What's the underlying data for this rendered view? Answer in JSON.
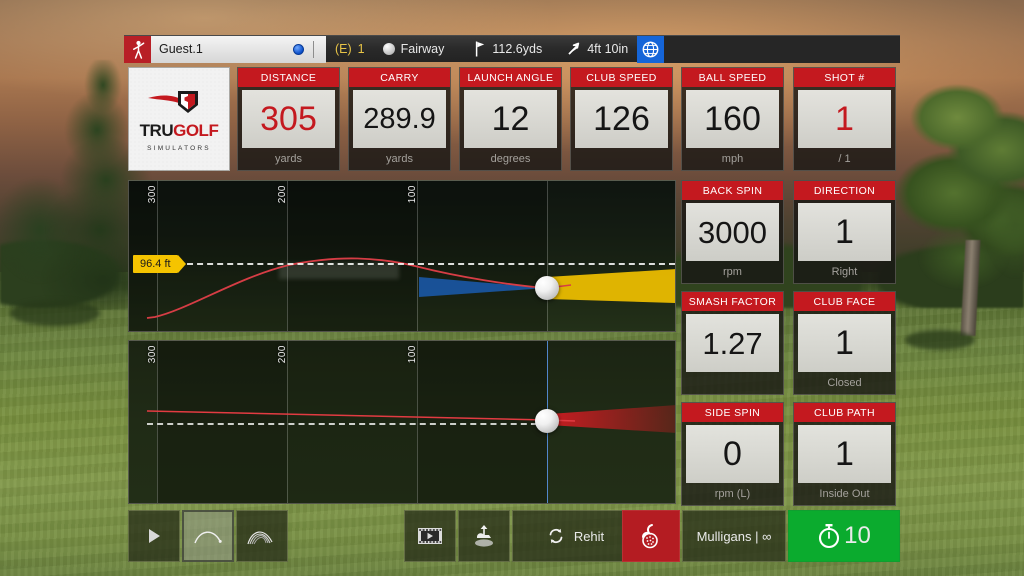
{
  "header": {
    "logo_icon": "golfer-swing-icon",
    "player_name": "Guest.1",
    "ball_marker_icon": "blue-ball-marker-icon",
    "score_paren": "(E)",
    "score_value": "1",
    "lie_ball_icon": "white-ball-icon",
    "lie": "Fairway",
    "flag_icon": "flag-icon",
    "distance_to_pin": "112.6yds",
    "elevation_icon": "up-right-arrow-icon",
    "elevation": "4ft 10in",
    "globe_icon": "globe-icon"
  },
  "brand": {
    "mark_icon": "trugolf-shield-icon",
    "name_part1": "TRU",
    "name_part2": "GOLF",
    "subtitle": "SIMULATORS"
  },
  "stats": [
    {
      "title": "DISTANCE",
      "value": "305",
      "unit": "yards",
      "accent": true
    },
    {
      "title": "CARRY",
      "value": "289.9",
      "unit": "yards",
      "accent": false
    },
    {
      "title": "LAUNCH ANGLE",
      "value": "12",
      "unit": "degrees",
      "accent": false
    },
    {
      "title": "CLUB SPEED",
      "value": "126",
      "unit": "",
      "accent": false
    },
    {
      "title": "BALL SPEED",
      "value": "160",
      "unit": "mph",
      "accent": false
    },
    {
      "title": "SHOT #",
      "value": "1",
      "unit": "/ 1",
      "accent": true
    },
    {
      "title": "BACK SPIN",
      "value": "3000",
      "unit": "rpm",
      "accent": false
    },
    {
      "title": "DIRECTION",
      "value": "1",
      "unit": "Right",
      "accent": false
    },
    {
      "title": "SMASH FACTOR",
      "value": "1.27",
      "unit": "",
      "accent": false
    },
    {
      "title": "CLUB FACE",
      "value": "1",
      "unit": "Closed",
      "accent": false
    },
    {
      "title": "SIDE SPIN",
      "value": "0",
      "unit": "rpm (L)",
      "accent": false
    },
    {
      "title": "CLUB PATH",
      "value": "1",
      "unit": "Inside Out",
      "accent": false
    }
  ],
  "side_view": {
    "name": "side-trajectory-view",
    "tick_labels": [
      "300",
      "200",
      "100"
    ],
    "apex_label": "96.4 ft"
  },
  "top_view": {
    "name": "top-down-trajectory-view",
    "tick_labels": [
      "300",
      "200",
      "100"
    ]
  },
  "toolbar": {
    "play_icon": "play-icon",
    "side_view_icon": "side-trajectory-icon",
    "multi_shot_icon": "multi-shot-trajectory-icon",
    "film_icon": "film-replay-icon",
    "drop_icon": "drop-ball-icon",
    "rehit_icon": "refresh-icon",
    "rehit_label": "Rehit",
    "mulligan_icon": "mulligan-ball-icon",
    "mulligans_label": "Mulligans | ∞",
    "timer_icon": "stopwatch-icon",
    "timer_value": "10"
  },
  "colors": {
    "accent_red": "#c4191f",
    "title_bar_red": "#c4191f",
    "apex_yellow": "#f5c400",
    "timer_green": "#0bab2e",
    "trace_red": "#d63d45",
    "cone_blue": "#1b63c4",
    "cone_yellow": "#f0c000",
    "score_yellow": "#e8c447"
  }
}
